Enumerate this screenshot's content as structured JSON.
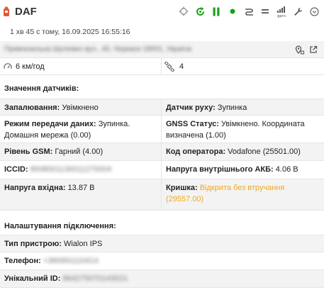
{
  "header": {
    "title": "DAF",
    "colors": {
      "accent_green": "#17a11a",
      "icon_gray": "#888888",
      "unit_icon": "#e05a3a"
    },
    "toolbar_icons": [
      "target-icon",
      "refresh-icon",
      "pause-icon",
      "status-dot-icon",
      "route-icon",
      "equals-icon",
      "gprs-icon",
      "wrench-icon",
      "chevron-down-icon"
    ],
    "gprs_label": "gprs"
  },
  "timestamp": "1 хв 45 с тому, 16.09.2025 16:55:16",
  "address": "Привокзальна Шулежко вул., 45, Черкаси 18001, Україна",
  "speed": "6 км/год",
  "satellites": "4",
  "sensors": {
    "title": "Значення датчиків:",
    "rows": [
      {
        "left_label": "Запалювання:",
        "left_value": "Увімкнено",
        "right_label": "Датчик руху:",
        "right_value": "Зупинка"
      },
      {
        "left_label": "Режим передачи даних:",
        "left_value": "Зупинка. Домашня мережа (0.00)",
        "right_label": "GNSS Статус:",
        "right_value": "Увімкнено. Координата визначена (1.00)"
      },
      {
        "left_label": "Рівень GSM:",
        "left_value": "Гарний (4.00)",
        "right_label": "Код оператора:",
        "right_value": "Vodafone (25501.00)"
      },
      {
        "left_label": "ICCID:",
        "left_value": "8938001130011270004",
        "right_label": "Напруга внутрішнього АКБ:",
        "right_value": "4.06 В"
      },
      {
        "left_label": "Напруга вхідна:",
        "left_value": "13.87 В",
        "right_label": "Кришка:",
        "right_value": "Відкрита без втручання (29557.00)"
      }
    ],
    "status_color": "#f0a81e"
  },
  "connection": {
    "title": "Налаштування підключення:",
    "rows": [
      {
        "label": "Тип пристрою:",
        "value": "Wialon IPS"
      },
      {
        "label": "Телефон:",
        "value": "+380991110414"
      },
      {
        "label": "Унікальний ID:",
        "value": "864275070143021"
      }
    ]
  }
}
